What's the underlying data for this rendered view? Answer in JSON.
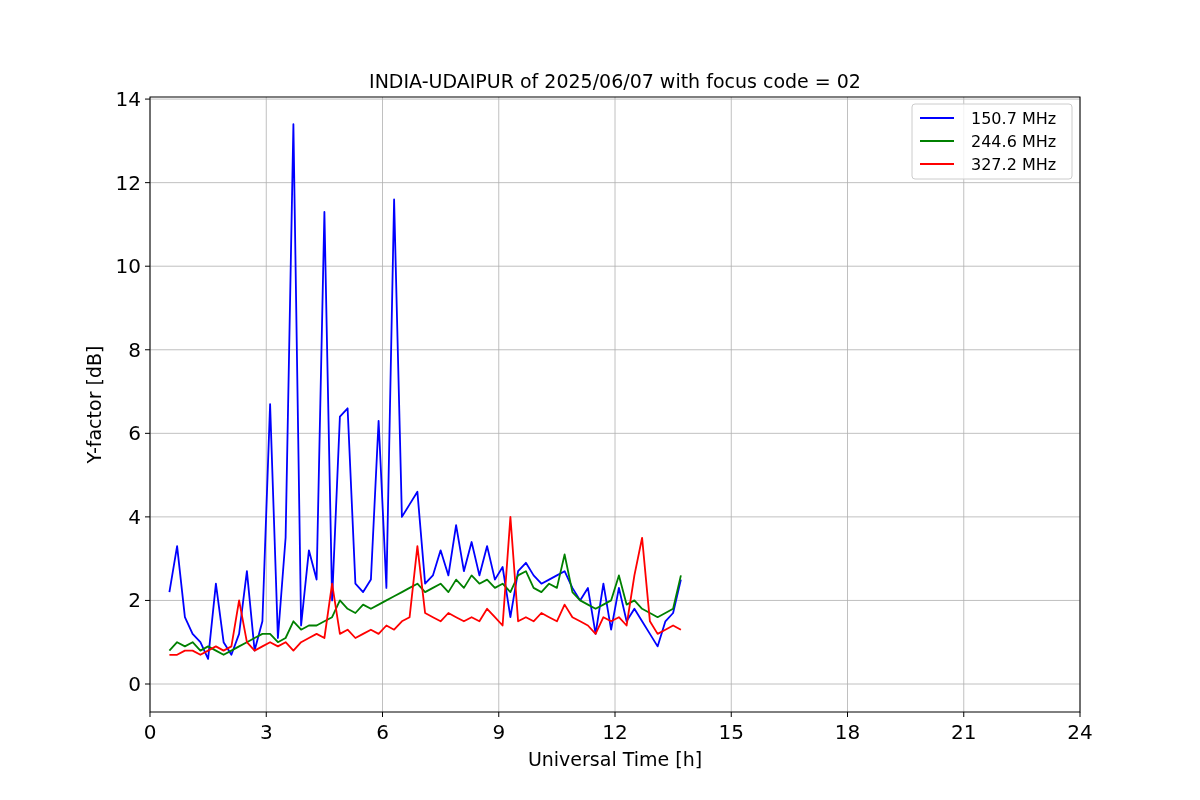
{
  "chart_data": {
    "type": "line",
    "title": "INDIA-UDAIPUR of 2025/06/07 with focus code = 02",
    "xlabel": "Universal Time [h]",
    "ylabel": "Y-factor [dB]",
    "xlim": [
      0,
      24
    ],
    "ylim": [
      -0.67,
      14.05
    ],
    "xticks": [
      0,
      3,
      6,
      9,
      12,
      15,
      18,
      21,
      24
    ],
    "yticks": [
      0,
      2,
      4,
      6,
      8,
      10,
      12,
      14
    ],
    "grid": true,
    "legend": true,
    "x": [
      0.5,
      0.7,
      0.9,
      1.1,
      1.3,
      1.5,
      1.7,
      1.9,
      2.1,
      2.3,
      2.5,
      2.7,
      2.9,
      3.1,
      3.3,
      3.5,
      3.7,
      3.9,
      4.1,
      4.3,
      4.5,
      4.7,
      4.9,
      5.1,
      5.3,
      5.5,
      5.7,
      5.9,
      6.1,
      6.3,
      6.5,
      6.7,
      6.9,
      7.1,
      7.3,
      7.5,
      7.7,
      7.9,
      8.1,
      8.3,
      8.5,
      8.7,
      8.9,
      9.1,
      9.3,
      9.5,
      9.7,
      9.9,
      10.1,
      10.3,
      10.5,
      10.7,
      10.9,
      11.1,
      11.3,
      11.5,
      11.7,
      11.9,
      12.1,
      12.3,
      12.5,
      12.7,
      12.9,
      13.1,
      13.3,
      13.5,
      13.7
    ],
    "series": [
      {
        "name": "150.7 MHz",
        "color": "#0000ff",
        "values": [
          2.2,
          3.3,
          1.6,
          1.2,
          1.0,
          0.6,
          2.4,
          1.0,
          0.7,
          1.2,
          2.7,
          0.8,
          1.5,
          6.7,
          1.1,
          3.5,
          13.4,
          1.4,
          3.2,
          2.5,
          11.3,
          2.0,
          6.4,
          6.6,
          2.4,
          2.2,
          2.5,
          6.3,
          2.3,
          11.6,
          4.0,
          4.3,
          4.6,
          2.4,
          2.6,
          3.2,
          2.6,
          3.8,
          2.7,
          3.4,
          2.6,
          3.3,
          2.5,
          2.8,
          1.6,
          2.7,
          2.9,
          2.6,
          2.4,
          2.5,
          2.6,
          2.7,
          2.3,
          2.0,
          2.3,
          1.2,
          2.4,
          1.3,
          2.3,
          1.5,
          1.8,
          1.5,
          1.2,
          0.9,
          1.5,
          1.7,
          2.5
        ]
      },
      {
        "name": "244.6 MHz",
        "color": "#008000",
        "values": [
          0.8,
          1.0,
          0.9,
          1.0,
          0.8,
          0.9,
          0.8,
          0.7,
          0.8,
          0.9,
          1.0,
          1.1,
          1.2,
          1.2,
          1.0,
          1.1,
          1.5,
          1.3,
          1.4,
          1.4,
          1.5,
          1.6,
          2.0,
          1.8,
          1.7,
          1.9,
          1.8,
          1.9,
          2.0,
          2.1,
          2.2,
          2.3,
          2.4,
          2.2,
          2.3,
          2.4,
          2.2,
          2.5,
          2.3,
          2.6,
          2.4,
          2.5,
          2.3,
          2.4,
          2.2,
          2.6,
          2.7,
          2.3,
          2.2,
          2.4,
          2.3,
          3.1,
          2.2,
          2.0,
          1.9,
          1.8,
          1.9,
          2.0,
          2.6,
          1.9,
          2.0,
          1.8,
          1.7,
          1.6,
          1.7,
          1.8,
          2.6
        ]
      },
      {
        "name": "327.2 MHz",
        "color": "#ff0000",
        "values": [
          0.7,
          0.7,
          0.8,
          0.8,
          0.7,
          0.8,
          0.9,
          0.8,
          0.9,
          2.0,
          1.0,
          0.8,
          0.9,
          1.0,
          0.9,
          1.0,
          0.8,
          1.0,
          1.1,
          1.2,
          1.1,
          2.4,
          1.2,
          1.3,
          1.1,
          1.2,
          1.3,
          1.2,
          1.4,
          1.3,
          1.5,
          1.6,
          3.3,
          1.7,
          1.6,
          1.5,
          1.7,
          1.6,
          1.5,
          1.6,
          1.5,
          1.8,
          1.6,
          1.4,
          4.0,
          1.5,
          1.6,
          1.5,
          1.7,
          1.6,
          1.5,
          1.9,
          1.6,
          1.5,
          1.4,
          1.2,
          1.6,
          1.5,
          1.6,
          1.4,
          2.6,
          3.5,
          1.5,
          1.2,
          1.3,
          1.4,
          1.3
        ]
      }
    ]
  }
}
